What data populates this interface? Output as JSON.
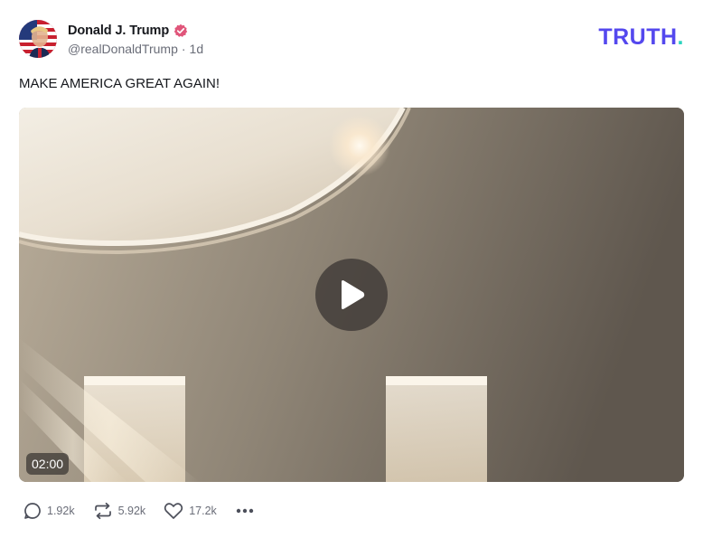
{
  "author": {
    "display_name": "Donald J. Trump",
    "handle": "@realDonaldTrump",
    "separator": "·",
    "age": "1d",
    "verified_icon": "verified-badge-icon",
    "verified_color": "#e0557a"
  },
  "brand": {
    "logo_text": "TRUTH",
    "logo_dot": ".",
    "logo_color": "#5448ee",
    "dot_color": "#2dd4bf"
  },
  "post": {
    "text": "MAKE AMERICA GREAT AGAIN!"
  },
  "media": {
    "type": "video",
    "duration": "02:00",
    "play_icon": "play-icon"
  },
  "actions": {
    "replies": {
      "icon": "reply-icon",
      "count": "1.92k"
    },
    "retruths": {
      "icon": "retruth-icon",
      "count": "5.92k"
    },
    "likes": {
      "icon": "heart-icon",
      "count": "17.2k"
    },
    "more": {
      "icon": "more-icon"
    }
  }
}
